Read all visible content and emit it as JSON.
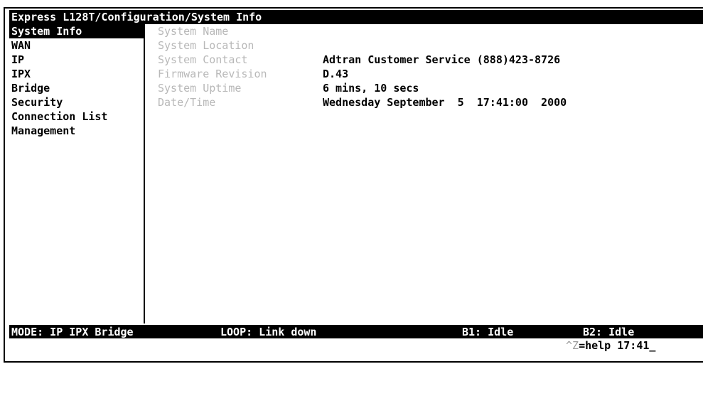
{
  "title_bar": {
    "text": "Express L128T/Configuration/System Info"
  },
  "sidebar": {
    "items": [
      {
        "label": "System Info",
        "selected": true
      },
      {
        "label": "WAN"
      },
      {
        "label": "IP"
      },
      {
        "label": "IPX"
      },
      {
        "label": "Bridge"
      },
      {
        "label": "Security"
      },
      {
        "label": "Connection List"
      },
      {
        "label": "Management"
      }
    ]
  },
  "system_info": {
    "fields": [
      {
        "label": "System Name",
        "value": ""
      },
      {
        "label": "System Location",
        "value": ""
      },
      {
        "label": "System Contact",
        "value": "Adtran Customer Service (888)423-8726"
      },
      {
        "label": "Firmware Revision",
        "value": "D.43"
      },
      {
        "label": "System Uptime",
        "value": "6 mins, 10 secs"
      },
      {
        "label": "Date/Time",
        "value": "Wednesday September  5  17:41:00  2000"
      }
    ]
  },
  "status_bar": {
    "mode": "MODE: IP IPX Bridge",
    "loop": "LOOP: Link down",
    "b1": "B1: Idle",
    "b2": "B2: Idle"
  },
  "help_line": {
    "ctrl": "^Z",
    "rest": "=help 17:41_"
  },
  "colors": {
    "background": "#ffffff",
    "foreground": "#000000",
    "dim_label": "#b8b8b8"
  }
}
